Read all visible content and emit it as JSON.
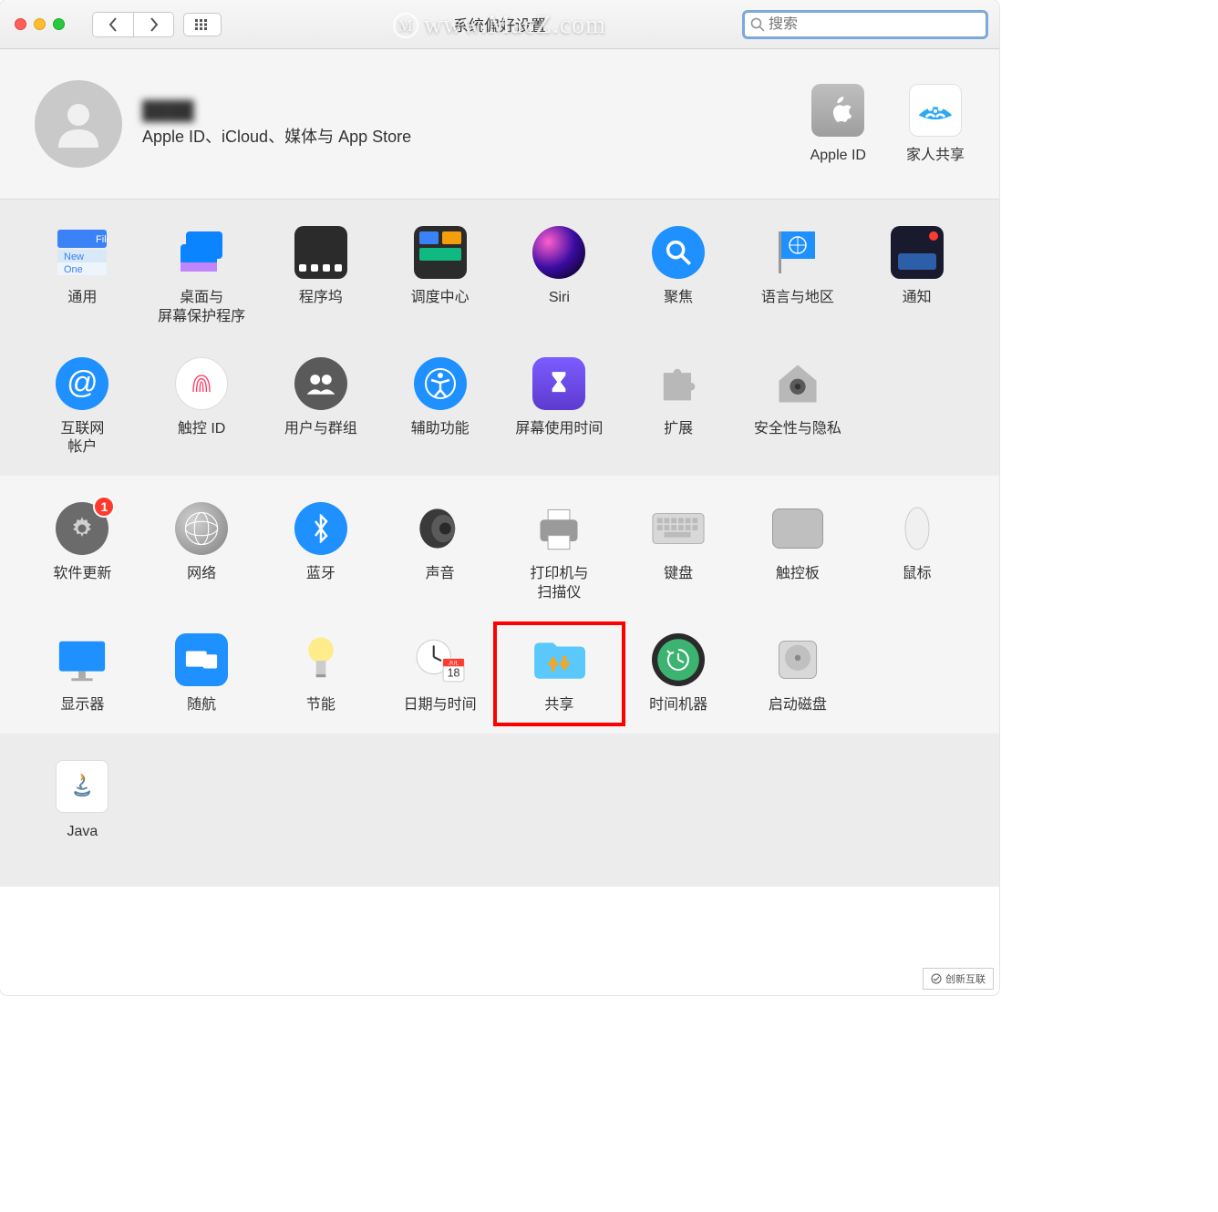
{
  "watermark": "www.MacZ.com",
  "footer_mark": "创新互联",
  "window": {
    "title": "系统偏好设置",
    "search_placeholder": "搜索"
  },
  "profile": {
    "name": "████",
    "subtitle": "Apple ID、iCloud、媒体与 App Store"
  },
  "top_right": [
    {
      "id": "apple-id",
      "label": "Apple ID"
    },
    {
      "id": "family-sharing",
      "label": "家人共享"
    }
  ],
  "row1": [
    {
      "id": "general",
      "label": "通用"
    },
    {
      "id": "desktop-screensaver",
      "label": "桌面与\n屏幕保护程序"
    },
    {
      "id": "dock",
      "label": "程序坞"
    },
    {
      "id": "mission-control",
      "label": "调度中心"
    },
    {
      "id": "siri",
      "label": "Siri"
    },
    {
      "id": "spotlight",
      "label": "聚焦"
    },
    {
      "id": "language-region",
      "label": "语言与地区"
    },
    {
      "id": "notifications",
      "label": "通知",
      "badge": true
    }
  ],
  "row2": [
    {
      "id": "internet-accounts",
      "label": "互联网\n帐户"
    },
    {
      "id": "touch-id",
      "label": "触控 ID"
    },
    {
      "id": "users-groups",
      "label": "用户与群组"
    },
    {
      "id": "accessibility",
      "label": "辅助功能"
    },
    {
      "id": "screen-time",
      "label": "屏幕使用时间"
    },
    {
      "id": "extensions",
      "label": "扩展"
    },
    {
      "id": "security-privacy",
      "label": "安全性与隐私"
    }
  ],
  "row3": [
    {
      "id": "software-update",
      "label": "软件更新",
      "badge": "1"
    },
    {
      "id": "network",
      "label": "网络"
    },
    {
      "id": "bluetooth",
      "label": "蓝牙"
    },
    {
      "id": "sound",
      "label": "声音"
    },
    {
      "id": "printers-scanners",
      "label": "打印机与\n扫描仪"
    },
    {
      "id": "keyboard",
      "label": "键盘"
    },
    {
      "id": "trackpad",
      "label": "触控板"
    },
    {
      "id": "mouse",
      "label": "鼠标"
    }
  ],
  "row4": [
    {
      "id": "displays",
      "label": "显示器"
    },
    {
      "id": "sidecar",
      "label": "随航"
    },
    {
      "id": "energy-saver",
      "label": "节能"
    },
    {
      "id": "date-time",
      "label": "日期与时间"
    },
    {
      "id": "sharing",
      "label": "共享",
      "highlighted": true
    },
    {
      "id": "time-machine",
      "label": "时间机器"
    },
    {
      "id": "startup-disk",
      "label": "启动磁盘"
    }
  ],
  "row5": [
    {
      "id": "java",
      "label": "Java"
    }
  ]
}
